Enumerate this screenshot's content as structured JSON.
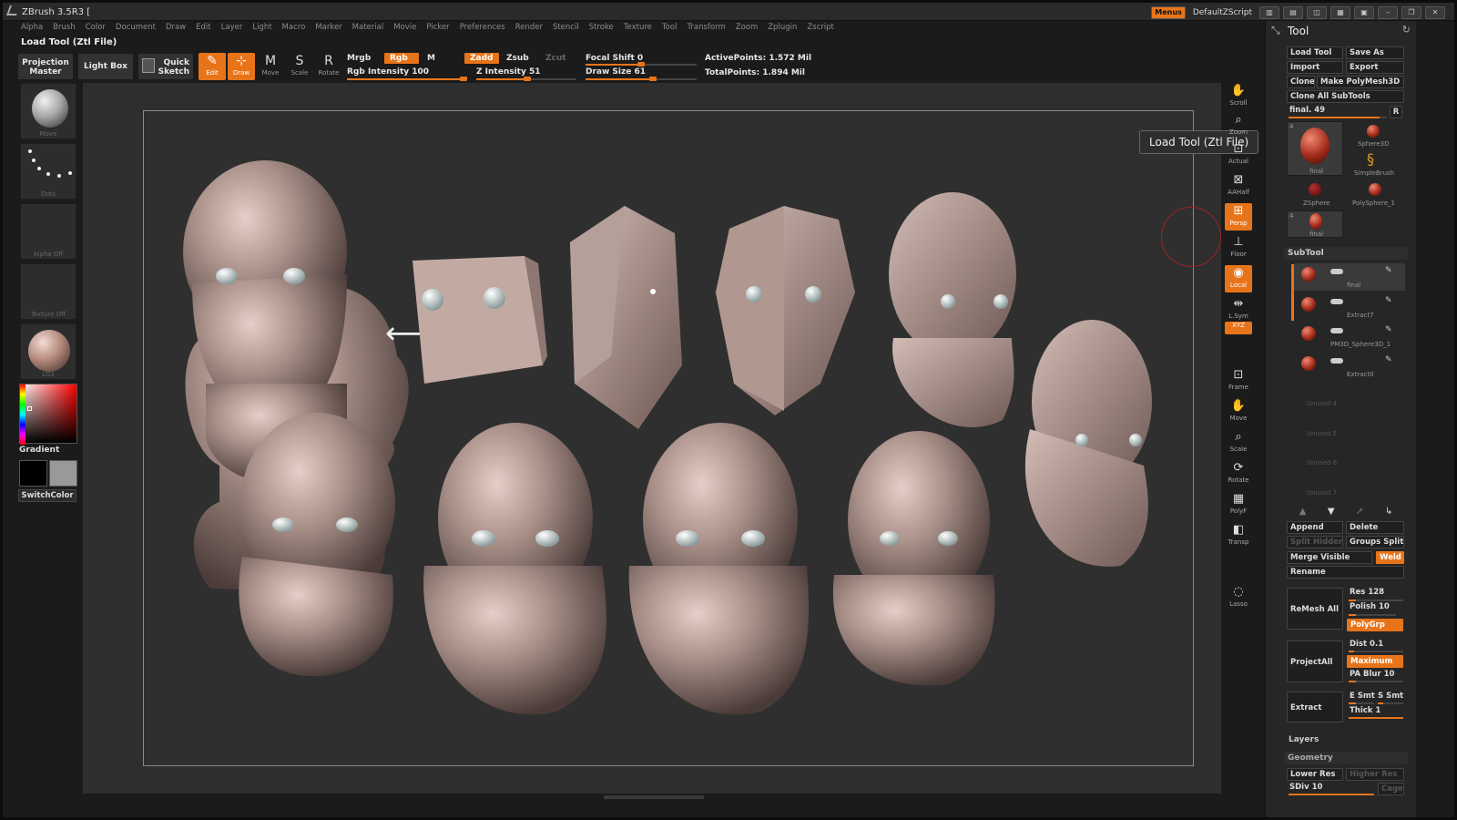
{
  "app": {
    "title": "ZBrush 3.5R3 [",
    "menus": [
      "Alpha",
      "Brush",
      "Color",
      "Document",
      "Draw",
      "Edit",
      "Layer",
      "Light",
      "Macro",
      "Marker",
      "Material",
      "Movie",
      "Picker",
      "Preferences",
      "Render",
      "Stencil",
      "Stroke",
      "Texture",
      "Tool",
      "Transform",
      "Zoom",
      "Zplugin",
      "Zscript"
    ],
    "menus_button": "Menus",
    "script_name": "DefaultZScript",
    "load_label": "Load Tool (Ztl File)"
  },
  "toolbar": {
    "projection_master": [
      "Projection",
      "Master"
    ],
    "light_box": "Light Box",
    "quick_sketch": [
      "Quick",
      "Sketch"
    ],
    "edit": "Edit",
    "draw": "Draw",
    "move": "Move",
    "scale": "Scale",
    "rotate": "Rotate",
    "mrgb": "Mrgb",
    "rgb": "Rgb",
    "m": "M",
    "zadd": "Zadd",
    "zsub": "Zsub",
    "zcut": "Zcut",
    "rgb_intensity": "Rgb Intensity 100",
    "z_intensity": "Z Intensity 51",
    "focal_shift": "Focal Shift 0",
    "draw_size": "Draw Size 61",
    "active_points": "ActivePoints: 1.572 Mil",
    "total_points": "TotalPoints: 1.894 Mil",
    "rgb_intensity_value": 100,
    "z_intensity_value": 51,
    "focal_shift_value": 0,
    "draw_size_value": 61
  },
  "leftshelf": {
    "move": "Move",
    "dots": "Dots",
    "alpha_off": "Alpha Off",
    "texture_off": "Texture Off",
    "material": "LG3",
    "gradient": "Gradient",
    "switch_color": "SwitchColor"
  },
  "rightshelf": {
    "items": [
      "Scroll",
      "Zoom",
      "Actual",
      "AAHalf",
      "Persp",
      "Floor",
      "Local",
      "L.Sym",
      "XYZ",
      "Frame",
      "Move",
      "Scale",
      "Rotate",
      "PolyF",
      "Transp",
      "Lasso"
    ],
    "active": [
      "Persp",
      "Local",
      "XYZ"
    ]
  },
  "canvas": {
    "tooltip": "Load Tool (Ztl File)",
    "arrow": "⟷"
  },
  "tool": {
    "title": "Tool",
    "load_tool": "Load Tool",
    "save_as": "Save As",
    "import": "Import",
    "export": "Export",
    "clone": "Clone",
    "make_polymesh": "Make PolyMesh3D",
    "clone_all": "Clone All SubTools",
    "final_slider": "final. 49",
    "r": "R",
    "thumbs": [
      {
        "name": "final",
        "count": "4"
      },
      {
        "name": "Sphere3D"
      },
      {
        "name": "SimpleBrush"
      },
      {
        "name": "ZSphere"
      },
      {
        "name": "PolySphere_1"
      },
      {
        "name": "final",
        "count": "4"
      }
    ],
    "subtool": {
      "title": "SubTool",
      "items": [
        "final",
        "Extract7",
        "PM3D_Sphere3D_1",
        "Extract0",
        "Unused 4",
        "Unused 5",
        "Unused 6",
        "Unused 7"
      ]
    },
    "append": "Append",
    "delete": "Delete",
    "split_hidden": "Split Hidden",
    "groups_split": "Groups Split",
    "merge_visible": "Merge Visible",
    "weld": "Weld",
    "rename": "Rename",
    "remesh_all": "ReMesh All",
    "res": "Res 128",
    "polish": "Polish 10",
    "polygrp": "PolyGrp",
    "project_all": "ProjectAll",
    "dist": "Dist 0.1",
    "maximum": "Maximum",
    "pa_blur": "PA Blur 10",
    "extract": "Extract",
    "e_smt": "E Smt",
    "s_smt": "S Smt",
    "thick": "Thick 1",
    "layers": "Layers",
    "geometry": "Geometry",
    "lower_res": "Lower Res",
    "higher_res": "Higher Res",
    "sdiv": "SDiv 10",
    "cage": "Cage"
  }
}
